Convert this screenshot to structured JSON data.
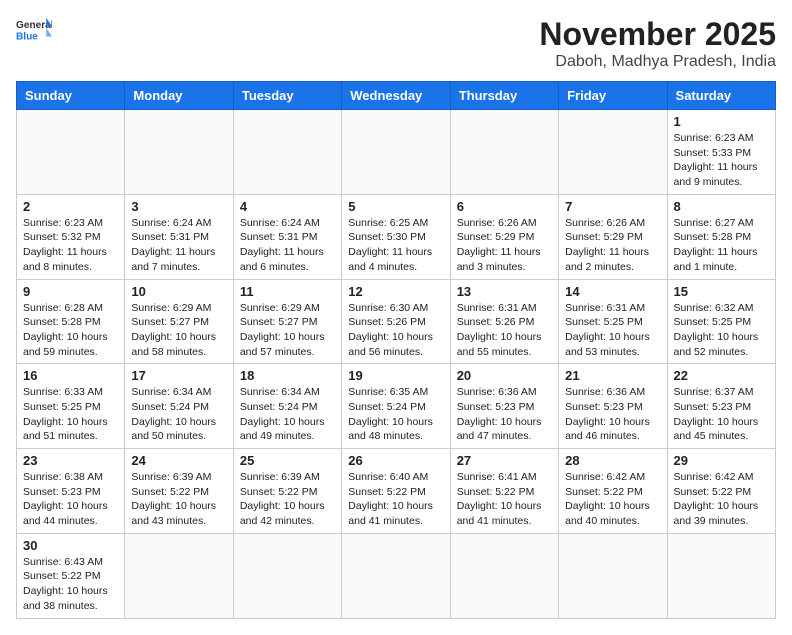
{
  "header": {
    "logo_general": "General",
    "logo_blue": "Blue",
    "month_title": "November 2025",
    "location": "Daboh, Madhya Pradesh, India"
  },
  "weekdays": [
    "Sunday",
    "Monday",
    "Tuesday",
    "Wednesday",
    "Thursday",
    "Friday",
    "Saturday"
  ],
  "weeks": [
    [
      {
        "day": "",
        "content": ""
      },
      {
        "day": "",
        "content": ""
      },
      {
        "day": "",
        "content": ""
      },
      {
        "day": "",
        "content": ""
      },
      {
        "day": "",
        "content": ""
      },
      {
        "day": "",
        "content": ""
      },
      {
        "day": "1",
        "content": "Sunrise: 6:23 AM\nSunset: 5:33 PM\nDaylight: 11 hours and 9 minutes."
      }
    ],
    [
      {
        "day": "2",
        "content": "Sunrise: 6:23 AM\nSunset: 5:32 PM\nDaylight: 11 hours and 8 minutes."
      },
      {
        "day": "3",
        "content": "Sunrise: 6:24 AM\nSunset: 5:31 PM\nDaylight: 11 hours and 7 minutes."
      },
      {
        "day": "4",
        "content": "Sunrise: 6:24 AM\nSunset: 5:31 PM\nDaylight: 11 hours and 6 minutes."
      },
      {
        "day": "5",
        "content": "Sunrise: 6:25 AM\nSunset: 5:30 PM\nDaylight: 11 hours and 4 minutes."
      },
      {
        "day": "6",
        "content": "Sunrise: 6:26 AM\nSunset: 5:29 PM\nDaylight: 11 hours and 3 minutes."
      },
      {
        "day": "7",
        "content": "Sunrise: 6:26 AM\nSunset: 5:29 PM\nDaylight: 11 hours and 2 minutes."
      },
      {
        "day": "8",
        "content": "Sunrise: 6:27 AM\nSunset: 5:28 PM\nDaylight: 11 hours and 1 minute."
      }
    ],
    [
      {
        "day": "9",
        "content": "Sunrise: 6:28 AM\nSunset: 5:28 PM\nDaylight: 10 hours and 59 minutes."
      },
      {
        "day": "10",
        "content": "Sunrise: 6:29 AM\nSunset: 5:27 PM\nDaylight: 10 hours and 58 minutes."
      },
      {
        "day": "11",
        "content": "Sunrise: 6:29 AM\nSunset: 5:27 PM\nDaylight: 10 hours and 57 minutes."
      },
      {
        "day": "12",
        "content": "Sunrise: 6:30 AM\nSunset: 5:26 PM\nDaylight: 10 hours and 56 minutes."
      },
      {
        "day": "13",
        "content": "Sunrise: 6:31 AM\nSunset: 5:26 PM\nDaylight: 10 hours and 55 minutes."
      },
      {
        "day": "14",
        "content": "Sunrise: 6:31 AM\nSunset: 5:25 PM\nDaylight: 10 hours and 53 minutes."
      },
      {
        "day": "15",
        "content": "Sunrise: 6:32 AM\nSunset: 5:25 PM\nDaylight: 10 hours and 52 minutes."
      }
    ],
    [
      {
        "day": "16",
        "content": "Sunrise: 6:33 AM\nSunset: 5:25 PM\nDaylight: 10 hours and 51 minutes."
      },
      {
        "day": "17",
        "content": "Sunrise: 6:34 AM\nSunset: 5:24 PM\nDaylight: 10 hours and 50 minutes."
      },
      {
        "day": "18",
        "content": "Sunrise: 6:34 AM\nSunset: 5:24 PM\nDaylight: 10 hours and 49 minutes."
      },
      {
        "day": "19",
        "content": "Sunrise: 6:35 AM\nSunset: 5:24 PM\nDaylight: 10 hours and 48 minutes."
      },
      {
        "day": "20",
        "content": "Sunrise: 6:36 AM\nSunset: 5:23 PM\nDaylight: 10 hours and 47 minutes."
      },
      {
        "day": "21",
        "content": "Sunrise: 6:36 AM\nSunset: 5:23 PM\nDaylight: 10 hours and 46 minutes."
      },
      {
        "day": "22",
        "content": "Sunrise: 6:37 AM\nSunset: 5:23 PM\nDaylight: 10 hours and 45 minutes."
      }
    ],
    [
      {
        "day": "23",
        "content": "Sunrise: 6:38 AM\nSunset: 5:23 PM\nDaylight: 10 hours and 44 minutes."
      },
      {
        "day": "24",
        "content": "Sunrise: 6:39 AM\nSunset: 5:22 PM\nDaylight: 10 hours and 43 minutes."
      },
      {
        "day": "25",
        "content": "Sunrise: 6:39 AM\nSunset: 5:22 PM\nDaylight: 10 hours and 42 minutes."
      },
      {
        "day": "26",
        "content": "Sunrise: 6:40 AM\nSunset: 5:22 PM\nDaylight: 10 hours and 41 minutes."
      },
      {
        "day": "27",
        "content": "Sunrise: 6:41 AM\nSunset: 5:22 PM\nDaylight: 10 hours and 41 minutes."
      },
      {
        "day": "28",
        "content": "Sunrise: 6:42 AM\nSunset: 5:22 PM\nDaylight: 10 hours and 40 minutes."
      },
      {
        "day": "29",
        "content": "Sunrise: 6:42 AM\nSunset: 5:22 PM\nDaylight: 10 hours and 39 minutes."
      }
    ],
    [
      {
        "day": "30",
        "content": "Sunrise: 6:43 AM\nSunset: 5:22 PM\nDaylight: 10 hours and 38 minutes."
      },
      {
        "day": "",
        "content": ""
      },
      {
        "day": "",
        "content": ""
      },
      {
        "day": "",
        "content": ""
      },
      {
        "day": "",
        "content": ""
      },
      {
        "day": "",
        "content": ""
      },
      {
        "day": "",
        "content": ""
      }
    ]
  ]
}
